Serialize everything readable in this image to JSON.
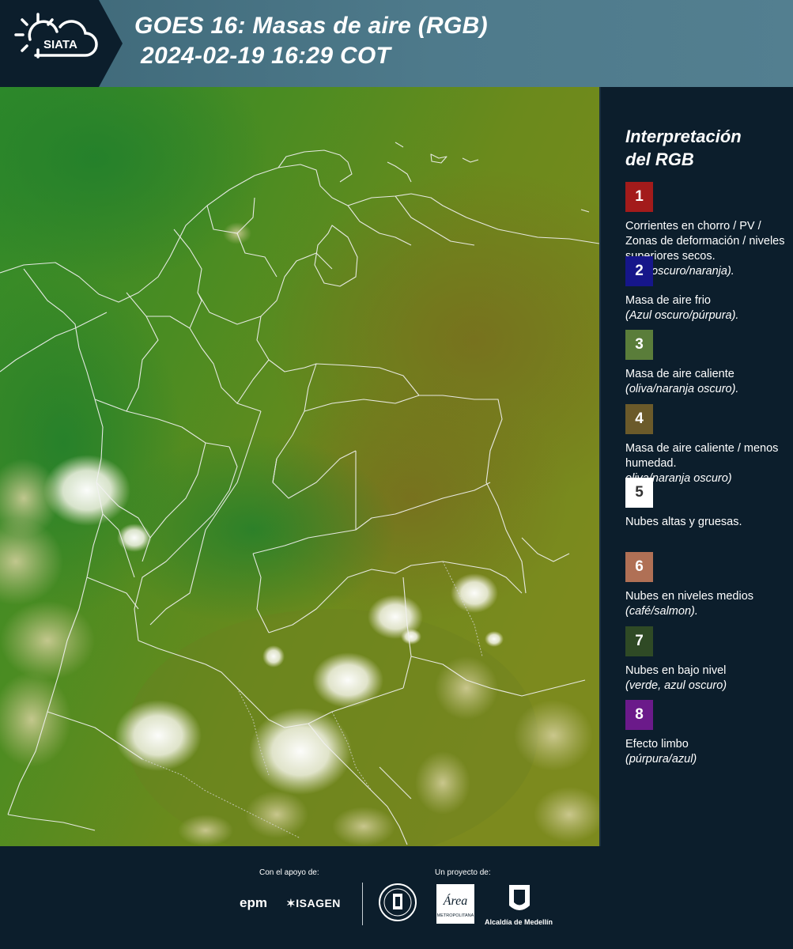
{
  "header": {
    "logo_text": "SIATA",
    "title_line1": "GOES 16: Masas de aire (RGB)",
    "title_line2": "2024-02-19 16:29 COT"
  },
  "sidebar": {
    "title_line1": "Interpretación",
    "title_line2": "del RGB",
    "items": [
      {
        "number": "1",
        "color": "#a31b1b",
        "text": "Corrientes en chorro / PV / Zonas de deformación / niveles superiores secos.",
        "note": "(rojo oscuro/naranja)."
      },
      {
        "number": "2",
        "color": "#16168a",
        "text": "Masa de aire frio",
        "note": "(Azul oscuro/púrpura)."
      },
      {
        "number": "3",
        "color": "#5a7d3a",
        "text": "Masa de aire caliente",
        "note": "(oliva/naranja oscuro)."
      },
      {
        "number": "4",
        "color": "#6b5a2a",
        "text": "Masa de aire caliente / menos humedad.",
        "note": "oliva/naranja oscuro)"
      },
      {
        "number": "5",
        "color": "#ffffff",
        "text": "Nubes altas y gruesas.",
        "note": ""
      },
      {
        "number": "6",
        "color": "#b07055",
        "text": "Nubes en niveles medios",
        "note": "(café/salmon)."
      },
      {
        "number": "7",
        "color": "#2f4a25",
        "text": "Nubes en bajo nivel",
        "note": "(verde, azul oscuro)"
      },
      {
        "number": "8",
        "color": "#6b1a8a",
        "text": "Efecto limbo",
        "note": "(púrpura/azul)"
      }
    ]
  },
  "footer": {
    "support_label": "Con el apoyo de:",
    "project_label": "Un proyecto de:",
    "epm": "epm",
    "isagen": "ISAGEN",
    "area_label": "Área",
    "area_sub": "METROPOLITANA",
    "alcaldia": "Alcaldía de Medellín"
  }
}
